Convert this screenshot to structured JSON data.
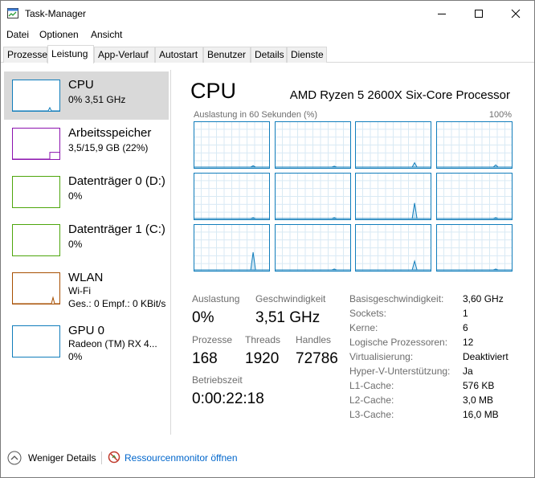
{
  "window": {
    "title": "Task-Manager"
  },
  "menu": [
    "Datei",
    "Optionen",
    "Ansicht"
  ],
  "tabs": [
    {
      "label": "Prozesse",
      "active": false
    },
    {
      "label": "Leistung",
      "active": true
    },
    {
      "label": "App-Verlauf",
      "active": false
    },
    {
      "label": "Autostart",
      "active": false
    },
    {
      "label": "Benutzer",
      "active": false
    },
    {
      "label": "Details",
      "active": false
    },
    {
      "label": "Dienste",
      "active": false
    }
  ],
  "sidebar": [
    {
      "title": "CPU",
      "line1": "0% 3,51 GHz",
      "line2": "",
      "color": "#117dbb",
      "selected": true,
      "level": 0.05
    },
    {
      "title": "Arbeitsspeicher",
      "line1": "3,5/15,9 GB (22%)",
      "line2": "",
      "color": "#8b12ae",
      "selected": false,
      "level": 0.22
    },
    {
      "title": "Datenträger 0 (D:)",
      "line1": "0%",
      "line2": "",
      "color": "#4da60c",
      "selected": false,
      "level": 0
    },
    {
      "title": "Datenträger 1 (C:)",
      "line1": "0%",
      "line2": "",
      "color": "#4da60c",
      "selected": false,
      "level": 0
    },
    {
      "title": "WLAN",
      "line1": "Wi-Fi",
      "line2": "Ges.: 0  Empf.: 0 KBit/s",
      "color": "#a74f01",
      "selected": false,
      "level": 0.2
    },
    {
      "title": "GPU 0",
      "line1": "Radeon (TM) RX 4...",
      "line2": "0%",
      "color": "#117dbb",
      "selected": false,
      "level": 0
    }
  ],
  "main": {
    "title": "CPU",
    "subtitle": "AMD Ryzen 5 2600X Six-Core Processor",
    "chart_label_left": "Auslastung in 60 Sekunden (%)",
    "chart_label_right": "100%",
    "core_spikes": [
      0.03,
      0.02,
      0.1,
      0.05,
      0.02,
      0.02,
      0.35,
      0.02,
      0.4,
      0.02,
      0.2,
      0.02
    ]
  },
  "stats": {
    "auslastung_label": "Auslastung",
    "auslastung_value": "0%",
    "geschw_label": "Geschwindigkeit",
    "geschw_value": "3,51 GHz",
    "prozesse_label": "Prozesse",
    "prozesse_value": "168",
    "threads_label": "Threads",
    "threads_value": "1920",
    "handles_label": "Handles",
    "handles_value": "72786",
    "betriebszeit_label": "Betriebszeit",
    "betriebszeit_value": "0:00:22:18"
  },
  "specs": [
    {
      "key": "Basisgeschwindigkeit:",
      "value": "3,60 GHz"
    },
    {
      "key": "Sockets:",
      "value": "1"
    },
    {
      "key": "Kerne:",
      "value": "6"
    },
    {
      "key": "Logische Prozessoren:",
      "value": "12"
    },
    {
      "key": "Virtualisierung:",
      "value": "Deaktiviert"
    },
    {
      "key": "Hyper-V-Unterstützung:",
      "value": "Ja"
    },
    {
      "key": "L1-Cache:",
      "value": "576 KB"
    },
    {
      "key": "L2-Cache:",
      "value": "3,0 MB"
    },
    {
      "key": "L3-Cache:",
      "value": "16,0 MB"
    }
  ],
  "footer": {
    "less_details": "Weniger Details",
    "resource_monitor": "Ressourcenmonitor öffnen",
    "link_color": "#0066cc"
  },
  "icons": [
    "task-manager-icon",
    "minimize-icon",
    "maximize-icon",
    "close-icon",
    "chevron-up-icon",
    "resource-monitor-icon"
  ]
}
